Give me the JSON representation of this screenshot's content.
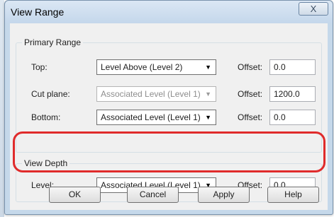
{
  "dialog": {
    "title": "View Range",
    "close_glyph": "X"
  },
  "primary_range": {
    "label": "Primary Range",
    "top": {
      "label": "Top:",
      "value": "Level Above (Level 2)",
      "offset_label": "Offset:",
      "offset": "0.0"
    },
    "cut_plane": {
      "label": "Cut plane:",
      "value": "Associated Level (Level 1)",
      "offset_label": "Offset:",
      "offset": "1200.0",
      "disabled": true
    },
    "bottom": {
      "label": "Bottom:",
      "value": "Associated Level (Level 1)",
      "offset_label": "Offset:",
      "offset": "0.0"
    }
  },
  "view_depth": {
    "label": "View Depth",
    "level": {
      "label": "Level:",
      "value": "Associated Level (Level 1)",
      "offset_label": "Offset:",
      "offset": "0.0"
    }
  },
  "buttons": {
    "ok": "OK",
    "cancel": "Cancel",
    "apply": "Apply",
    "help": "Help"
  },
  "colors": {
    "highlight": "#e02b2b",
    "frame": "#c5d8ea"
  },
  "icons": {
    "combo_arrow": "dropdown-arrow-icon",
    "close": "close-icon"
  }
}
